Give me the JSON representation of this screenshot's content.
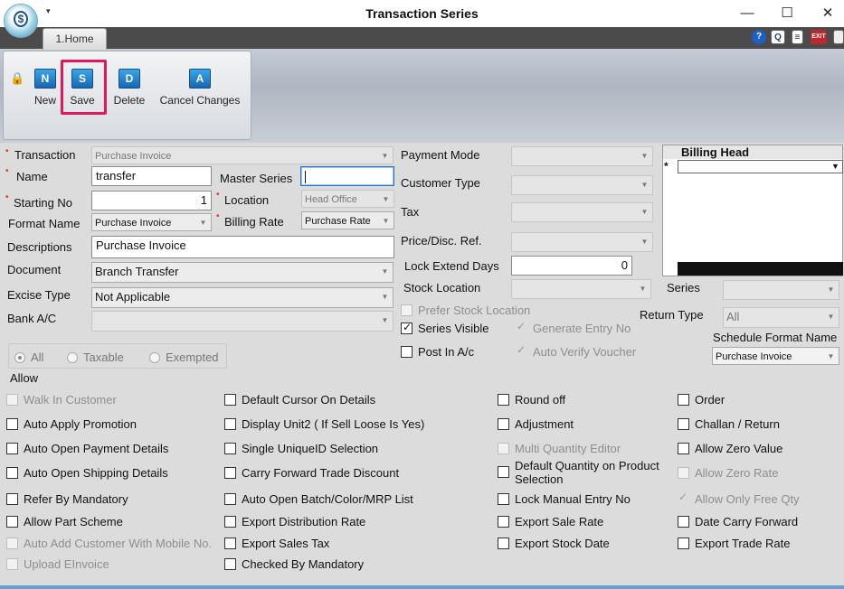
{
  "window": {
    "title": "Transaction Series",
    "minimize": "—",
    "maximize": "☐",
    "close": "✕",
    "qa_menu": "▾"
  },
  "tabs": [
    {
      "label": "1.Home"
    }
  ],
  "toolbar": {
    "new_label": "New",
    "save_label": "Save",
    "delete_label": "Delete",
    "cancel_label": "Cancel Changes",
    "new_glyph": "N",
    "save_glyph": "S",
    "delete_glyph": "D",
    "cancel_glyph": "A"
  },
  "tab_icons": {
    "help": "?",
    "find": "Q",
    "doc": "≡",
    "exit": "EXIT"
  },
  "form": {
    "transaction_label": "Transaction",
    "transaction_value": "Purchase Invoice",
    "name_label": "Name",
    "name_value": "transfer",
    "master_series_label": "Master Series",
    "master_series_value": "",
    "starting_no_label": "Starting No",
    "starting_no_value": "1",
    "location_label": "Location",
    "location_value": "Head Office",
    "format_name_label": "Format Name",
    "format_name_value": "Purchase Invoice",
    "billing_rate_label": "Billing Rate",
    "billing_rate_value": "Purchase Rate",
    "descriptions_label": "Descriptions",
    "descriptions_value": "Purchase Invoice",
    "document_label": "Document",
    "document_value": "Branch Transfer",
    "excise_type_label": "Excise Type",
    "excise_type_value": "Not Applicable",
    "bank_ac_label": "Bank A/C",
    "bank_ac_value": "",
    "payment_mode_label": "Payment Mode",
    "payment_mode_value": "",
    "customer_type_label": "Customer Type",
    "customer_type_value": "",
    "tax_label": "Tax",
    "tax_value": "",
    "price_disc_label": "Price/Disc. Ref.",
    "price_disc_value": "",
    "lock_extend_label": "Lock Extend Days",
    "lock_extend_value": "0",
    "stock_location_label": "Stock Location",
    "stock_location_value": "",
    "prefer_stock_location": "Prefer Stock Location",
    "series_visible": "Series Visible",
    "generate_entry_no": "Generate Entry No",
    "post_in_ac": "Post In A/c",
    "auto_verify_voucher": "Auto Verify Voucher",
    "series_label": "Series",
    "series_value": "",
    "return_type_label": "Return Type",
    "return_type_value": "All",
    "schedule_format_label": "Schedule Format Name",
    "schedule_format_value": "Purchase Invoice"
  },
  "billing_head": {
    "title": "Billing Head",
    "star": "*"
  },
  "radio": {
    "all": "All",
    "taxable": "Taxable",
    "exempted": "Exempted"
  },
  "allow": {
    "title": "Allow",
    "col1": [
      "Walk In Customer",
      "Auto Apply Promotion",
      "Auto Open Payment Details",
      "Auto Open Shipping Details",
      "Refer By Mandatory",
      "Allow Part Scheme",
      "Auto Add Customer With Mobile No.",
      "Upload EInvoice"
    ],
    "col2": [
      "Default Cursor On Details",
      "Display Unit2 ( If Sell Loose Is Yes)",
      "Single UniqueID Selection",
      "Carry Forward Trade Discount",
      "Auto Open Batch/Color/MRP List",
      "Export Distribution Rate",
      "Export Sales Tax",
      "Checked By Mandatory"
    ],
    "col3": [
      "Round off",
      "Adjustment",
      "Multi Quantity Editor",
      "Default Quantity on Product Selection",
      "Lock Manual Entry No",
      "Export Sale Rate",
      "Export Stock Date"
    ],
    "col4": [
      "Order",
      "Challan / Return",
      "Allow Zero Value",
      "Allow Zero Rate",
      "Allow Only Free Qty",
      "Date Carry Forward",
      "Export Trade Rate"
    ]
  }
}
